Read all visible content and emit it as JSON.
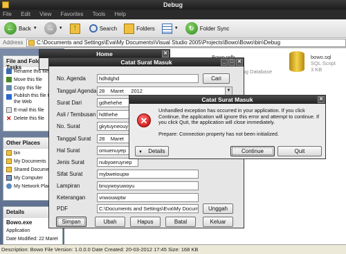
{
  "explorer": {
    "title": "Debug",
    "menu": [
      "File",
      "Edit",
      "View",
      "Favorites",
      "Tools",
      "Help"
    ],
    "toolbar": {
      "back": "Back",
      "search": "Search",
      "folders": "Folders",
      "folder_sync": "Folder Sync"
    },
    "address_label": "Address",
    "address": "C:\\Documents and Settings\\Eva\\My Documents\\Visual Studio 2005\\Projects\\Bowo\\Bowo\\bin\\Debug",
    "file_tasks": {
      "header": "File and Folder Tasks",
      "items": [
        "Rename this file",
        "Move this file",
        "Copy this file",
        "Publish this file to the Web",
        "E-mail this file",
        "Delete this file"
      ]
    },
    "other_places": {
      "header": "Other Places",
      "items": [
        "bin",
        "My Documents",
        "Shared Documents",
        "My Computer",
        "My Network Places"
      ]
    },
    "details": {
      "header": "Details",
      "name": "Bowo.exe",
      "type": "Application",
      "modified": "Date Modified: 22 Maret"
    },
    "files": [
      {
        "name": "Bowo.pdb",
        "type": "Program Debug Database"
      },
      {
        "name": "bowo.sql",
        "type": "SQL Script",
        "size": "3 KB"
      }
    ],
    "status": "Description: Bowo File Version: 1.0.0.0 Date Created: 20-03-2012 17:45 Size: 168 KB"
  },
  "home": {
    "title": "Home"
  },
  "form": {
    "title": "Catat Surat Masuk",
    "labels": [
      "No. Agenda",
      "Tanggal Agenda",
      "Surat Dari",
      "Asli / Tembusan",
      "No. Surat",
      "Tanggal Surat",
      "Hal Surat",
      "Jenis Surat",
      "Sifat Surat",
      "Lampiran",
      "Keterangan",
      "PDF"
    ],
    "no_agenda": "hdhdghd",
    "tgl_agenda": {
      "day": "28",
      "month": "Maret",
      "year": "2012"
    },
    "surat_dari": "gdhehehe",
    "asli_tembusan": "hdthehe",
    "no_surat": "gkytuyneouy",
    "tgl_surat": {
      "day": "28",
      "month": "Maret"
    },
    "hal_surat": "omuenuyep",
    "jenis_surat": "nubyoeruynep",
    "sifat_surat": "mybweioupw",
    "lampiran": "bnuywoyuwoyu",
    "keterangan": "vnwouwptw",
    "pdf": "C:\\Documents and Settings\\Eva\\My Documen",
    "buttons": {
      "cari": "Cari",
      "unggah": "Unggah",
      "simpan": "Simpan",
      "ubah": "Ubah",
      "hapus": "Hapus",
      "batal": "Batal",
      "keluar": "Keluar"
    }
  },
  "dialog": {
    "title": "Catat Surat Masuk",
    "message": "Unhandled exception has occurred in your application. If you click Continue, the application will ignore this error and attempt to continue. If you click Quit, the application will close immediately.",
    "detail": "Prepare: Connection property has not been initialized.",
    "details_btn": "Details",
    "continue_btn": "Continue",
    "quit_btn": "Quit"
  }
}
